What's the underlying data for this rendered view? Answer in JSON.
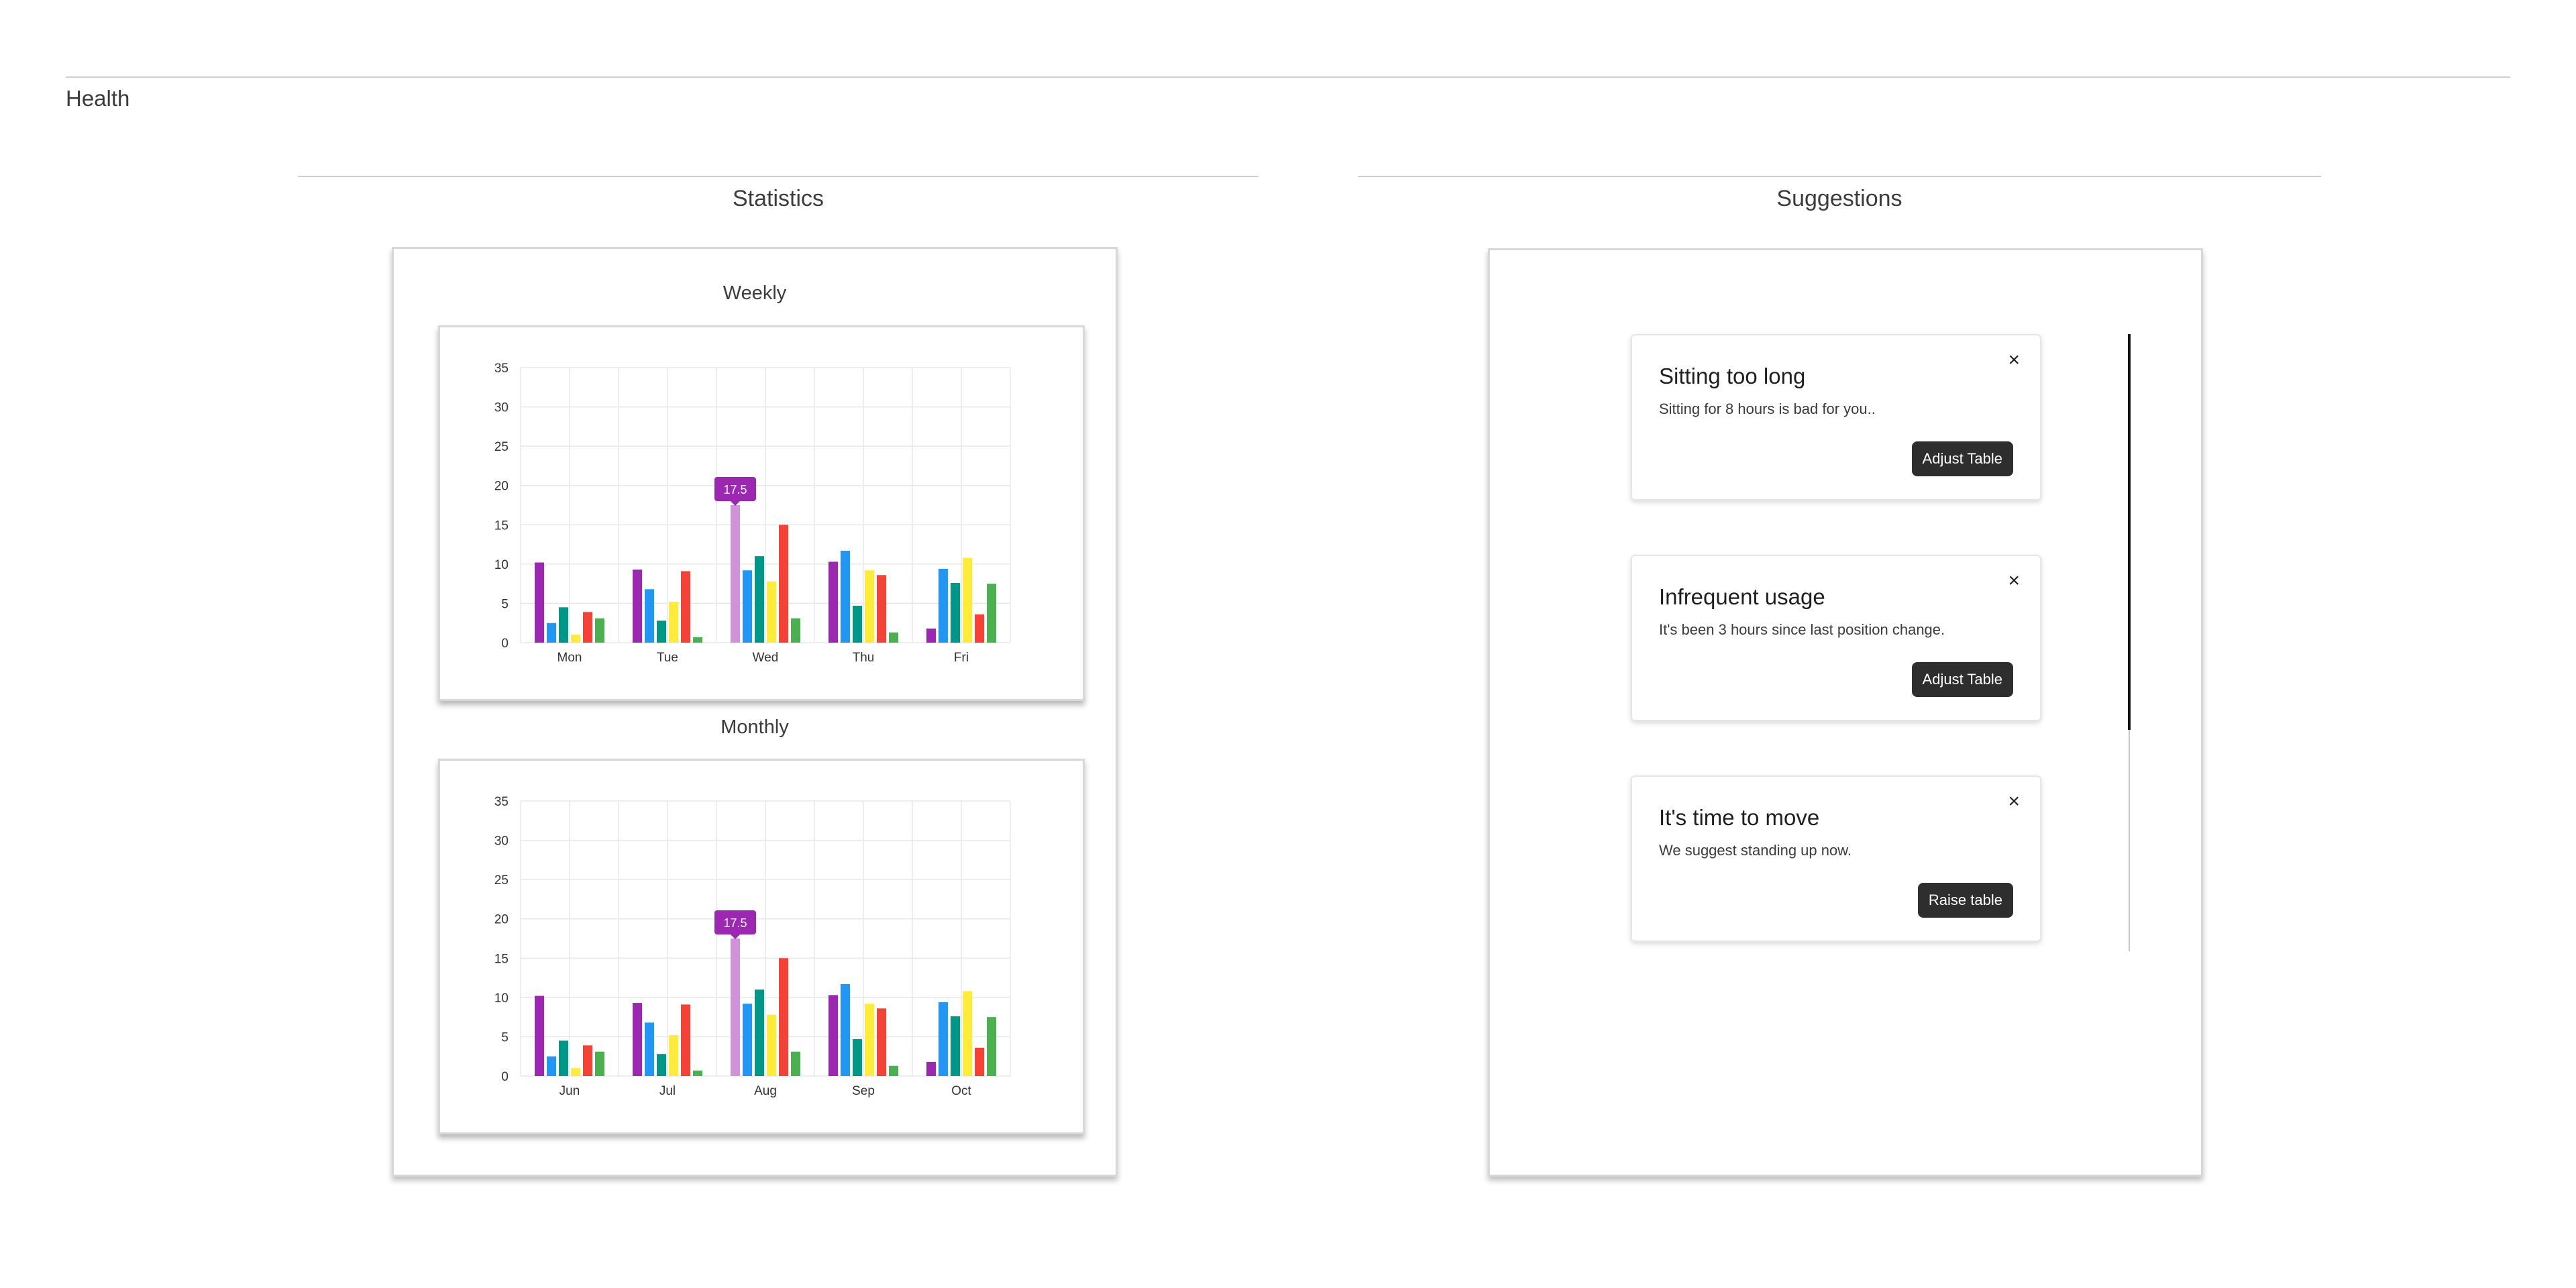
{
  "page": {
    "title": "Health"
  },
  "statistics": {
    "title": "Statistics",
    "charts": [
      {
        "title": "Weekly",
        "categories": [
          "Mon",
          "Tue",
          "Wed",
          "Thu",
          "Fri"
        ]
      },
      {
        "title": "Monthly",
        "categories": [
          "Jun",
          "Jul",
          "Aug",
          "Sep",
          "Oct"
        ]
      }
    ]
  },
  "chart_data": [
    {
      "type": "bar",
      "title": "Weekly",
      "categories": [
        "Mon",
        "Tue",
        "Wed",
        "Thu",
        "Fri"
      ],
      "ylim": [
        0,
        35
      ],
      "yticks": [
        0,
        5,
        10,
        15,
        20,
        25,
        30,
        35
      ],
      "grid": true,
      "series": [
        {
          "color": "#9c27b0",
          "values": [
            10.2,
            9.3,
            17.5,
            10.3,
            1.8
          ]
        },
        {
          "color": "#2196f3",
          "values": [
            2.5,
            6.8,
            9.2,
            11.7,
            9.4
          ]
        },
        {
          "color": "#009688",
          "values": [
            4.5,
            2.8,
            11.0,
            4.7,
            7.6
          ]
        },
        {
          "color": "#ffeb3b",
          "values": [
            1.0,
            5.2,
            7.8,
            9.2,
            10.8
          ]
        },
        {
          "color": "#f44336",
          "values": [
            3.9,
            9.1,
            15.0,
            8.6,
            3.6
          ]
        },
        {
          "color": "#4caf50",
          "values": [
            3.1,
            0.7,
            3.1,
            1.3,
            7.5
          ]
        }
      ],
      "tooltip": {
        "label": "17.5",
        "category_index": 2,
        "series_index": 0,
        "color": "#9c27b0",
        "highlight": "#ce93d8"
      }
    },
    {
      "type": "bar",
      "title": "Monthly",
      "categories": [
        "Jun",
        "Jul",
        "Aug",
        "Sep",
        "Oct"
      ],
      "ylim": [
        0,
        35
      ],
      "yticks": [
        0,
        5,
        10,
        15,
        20,
        25,
        30,
        35
      ],
      "grid": true,
      "series": [
        {
          "color": "#9c27b0",
          "values": [
            10.2,
            9.3,
            17.5,
            10.3,
            1.8
          ]
        },
        {
          "color": "#2196f3",
          "values": [
            2.5,
            6.8,
            9.2,
            11.7,
            9.4
          ]
        },
        {
          "color": "#009688",
          "values": [
            4.5,
            2.8,
            11.0,
            4.7,
            7.6
          ]
        },
        {
          "color": "#ffeb3b",
          "values": [
            1.0,
            5.2,
            7.8,
            9.2,
            10.8
          ]
        },
        {
          "color": "#f44336",
          "values": [
            3.9,
            9.1,
            15.0,
            8.6,
            3.6
          ]
        },
        {
          "color": "#4caf50",
          "values": [
            3.1,
            0.7,
            3.1,
            1.3,
            7.5
          ]
        }
      ],
      "tooltip": {
        "label": "17.5",
        "category_index": 2,
        "series_index": 0,
        "color": "#9c27b0",
        "highlight": "#ce93d8"
      }
    }
  ],
  "suggestions": {
    "title": "Suggestions",
    "cards": [
      {
        "title": "Sitting too long",
        "text": "Sitting for 8 hours is bad for you..",
        "button": "Adjust Table",
        "close": "×"
      },
      {
        "title": "Infrequent usage",
        "text": "It's been 3 hours since last position change.",
        "button": "Adjust Table",
        "close": "×"
      },
      {
        "title": "It's time to move",
        "text": "We suggest standing up now.",
        "button": "Raise table",
        "close": "×"
      }
    ]
  }
}
